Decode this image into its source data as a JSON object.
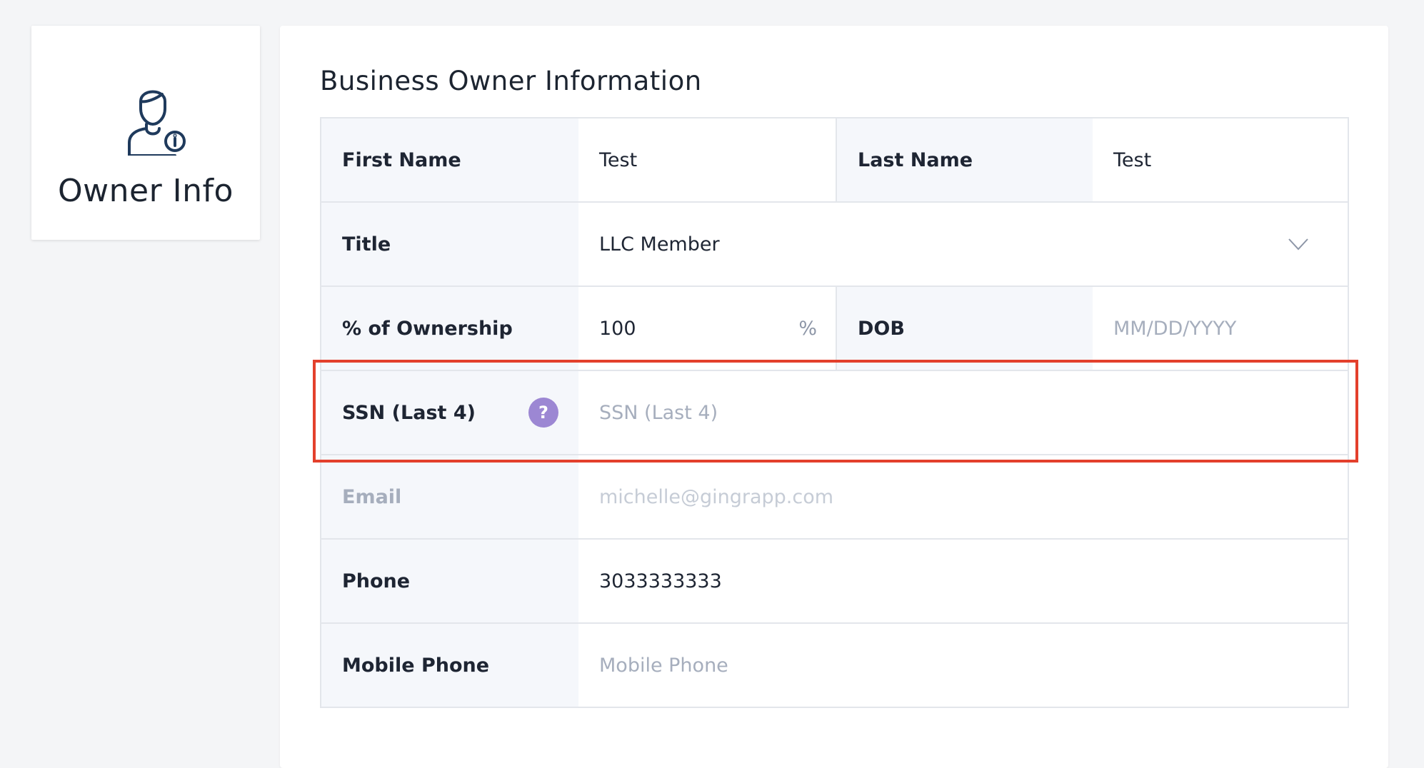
{
  "sidebar": {
    "title": "Owner Info",
    "icon": "owner-info-icon"
  },
  "form": {
    "title": "Business Owner Information",
    "first_name": {
      "label": "First Name",
      "value": "Test"
    },
    "last_name": {
      "label": "Last Name",
      "value": "Test"
    },
    "title_field": {
      "label": "Title",
      "value": "LLC Member"
    },
    "ownership": {
      "label": "% of Ownership",
      "value": "100",
      "suffix": "%"
    },
    "dob": {
      "label": "DOB",
      "placeholder": "MM/DD/YYYY"
    },
    "ssn": {
      "label": "SSN (Last 4)",
      "placeholder": "SSN (Last 4)",
      "help": "?"
    },
    "email": {
      "label": "Email",
      "value": "michelle@gingrapp.com"
    },
    "phone": {
      "label": "Phone",
      "value": "3033333333"
    },
    "mobile_phone": {
      "label": "Mobile Phone",
      "placeholder": "Mobile Phone"
    }
  },
  "colors": {
    "highlight": "#e3402c",
    "help_badge": "#9c87d3",
    "label_bg": "#f5f7fb"
  }
}
